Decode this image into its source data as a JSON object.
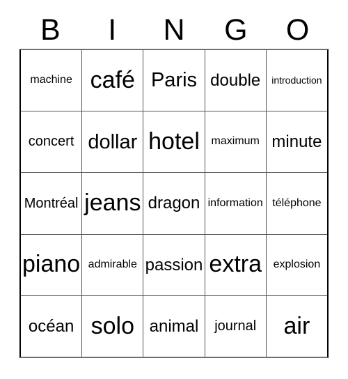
{
  "card": {
    "header_letters": [
      "B",
      "I",
      "N",
      "G",
      "O"
    ],
    "rows": [
      [
        {
          "text": "machine",
          "size": "s"
        },
        {
          "text": "café",
          "size": "xxl"
        },
        {
          "text": "Paris",
          "size": "xl"
        },
        {
          "text": "double",
          "size": "l"
        },
        {
          "text": "introduction",
          "size": "xs"
        }
      ],
      [
        {
          "text": "concert",
          "size": "m"
        },
        {
          "text": "dollar",
          "size": "xl"
        },
        {
          "text": "hotel",
          "size": "xxl"
        },
        {
          "text": "maximum",
          "size": "s"
        },
        {
          "text": "minute",
          "size": "l"
        }
      ],
      [
        {
          "text": "Montréal",
          "size": "m"
        },
        {
          "text": "jeans",
          "size": "xxl"
        },
        {
          "text": "dragon",
          "size": "l"
        },
        {
          "text": "information",
          "size": "s"
        },
        {
          "text": "téléphone",
          "size": "s"
        }
      ],
      [
        {
          "text": "piano",
          "size": "xxl"
        },
        {
          "text": "admirable",
          "size": "s"
        },
        {
          "text": "passion",
          "size": "l"
        },
        {
          "text": "extra",
          "size": "xxl"
        },
        {
          "text": "explosion",
          "size": "s"
        }
      ],
      [
        {
          "text": "océan",
          "size": "l"
        },
        {
          "text": "solo",
          "size": "xxl"
        },
        {
          "text": "animal",
          "size": "l"
        },
        {
          "text": "journal",
          "size": "m"
        },
        {
          "text": "air",
          "size": "xxl"
        }
      ]
    ],
    "colors": {
      "background": "#ffffff",
      "text": "#000000",
      "grid_line": "#555555",
      "outer_border": "#000000"
    }
  }
}
